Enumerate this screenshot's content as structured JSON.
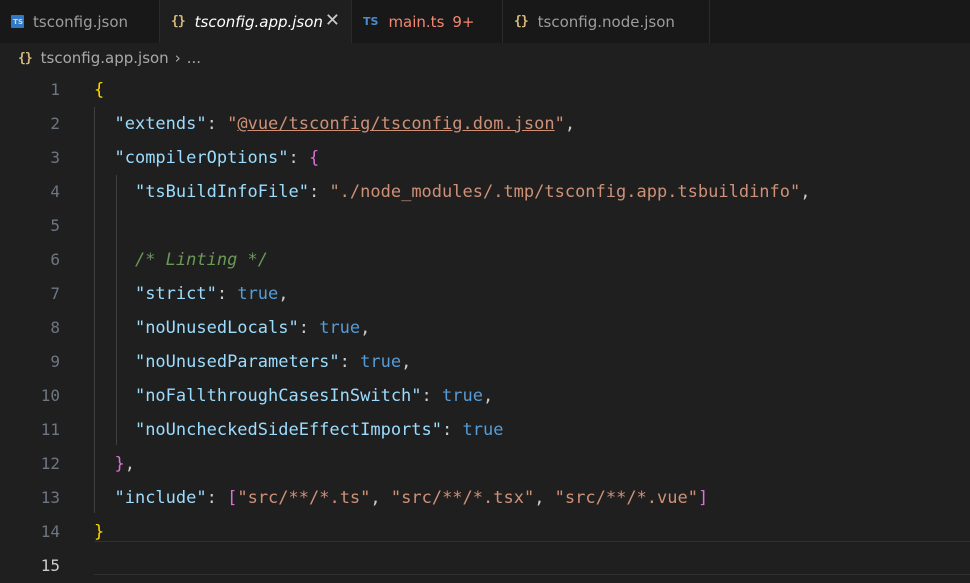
{
  "tabs": [
    {
      "label": "tsconfig.json",
      "icon": "typescript-config-icon"
    },
    {
      "label": "tsconfig.app.json",
      "icon": "json-braces-icon"
    },
    {
      "label": "main.ts",
      "icon": "typescript-file-icon",
      "badge": "9+",
      "icon_text": "TS"
    },
    {
      "label": "tsconfig.node.json",
      "icon": "json-braces-icon"
    }
  ],
  "icons": {
    "json": "{}",
    "close": "✕",
    "chevron": "›",
    "ts_small": "TS"
  },
  "breadcrumb": {
    "file": "tsconfig.app.json",
    "more": "..."
  },
  "editor": {
    "line_numbers": [
      "1",
      "2",
      "3",
      "4",
      "5",
      "6",
      "7",
      "8",
      "9",
      "10",
      "11",
      "12",
      "13",
      "14",
      "15"
    ],
    "tokens": {
      "open_brace": "{",
      "close_brace": "}",
      "extends_key": "\"extends\"",
      "extends_value_q1": "\"",
      "extends_value_link": "@vue/tsconfig/tsconfig.dom.json",
      "extends_value_q2": "\"",
      "compiler_key": "\"compilerOptions\"",
      "compiler_open": "{",
      "tsbuild_key": "\"tsBuildInfoFile\"",
      "tsbuild_value": "\"./node_modules/.tmp/tsconfig.app.tsbuildinfo\"",
      "comment": "/* Linting */",
      "strict_key": "\"strict\"",
      "nounusedlocals_key": "\"noUnusedLocals\"",
      "nounusedparams_key": "\"noUnusedParameters\"",
      "nofallthrough_key": "\"noFallthroughCasesInSwitch\"",
      "nounchecked_key": "\"noUncheckedSideEffectImports\"",
      "true_value": "true",
      "compiler_close": "}",
      "include_key": "\"include\"",
      "include_open": "[",
      "include_items": [
        "\"src/**/*.ts\"",
        "\"src/**/*.tsx\"",
        "\"src/**/*.vue\""
      ],
      "include_close": "]",
      "colon": ": ",
      "comma": ",",
      "comma_space": ", "
    }
  },
  "colors": {
    "background": "#1f1f1f",
    "key": "#9cdcfe",
    "string": "#ce9178",
    "boolean": "#569cd6",
    "comment": "#6a9955",
    "bracket_level1": "#ffd700",
    "bracket_level2": "#da70d6",
    "bracket_level3": "#179fff",
    "error": "#f48771"
  }
}
